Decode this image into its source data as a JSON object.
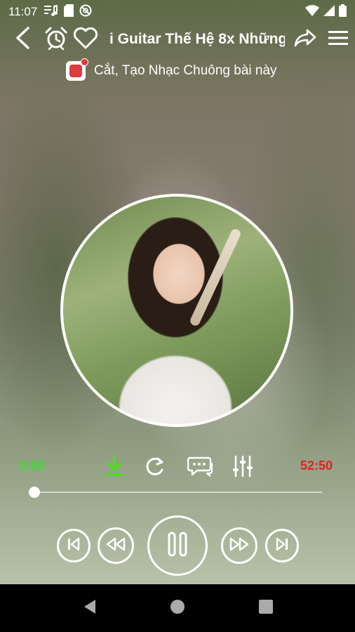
{
  "status_bar": {
    "time": "11:07",
    "icons": [
      "music-notification-icon",
      "sd-card-icon",
      "no-disturb-icon",
      "wifi-icon",
      "signal-icon",
      "battery-icon"
    ]
  },
  "header": {
    "title": "i Guitar Thế Hệ 8x Những",
    "icons": [
      "back-icon",
      "alarm-icon",
      "heart-icon",
      "share-icon",
      "menu-icon"
    ]
  },
  "ringtone": {
    "label": "Cắt, Tạo Nhạc Chuông bài này"
  },
  "player": {
    "current_time": "0:03",
    "total_time": "52:50",
    "progress": 0.001,
    "tools": [
      "download-icon",
      "repeat-icon",
      "lyrics-icon",
      "equalizer-icon"
    ],
    "controls": [
      "skip-previous-icon",
      "rewind-icon",
      "pause-icon",
      "fast-forward-icon",
      "skip-next-icon"
    ]
  },
  "colors": {
    "current_time": "#3ae02a",
    "total_time": "#e22121",
    "download": "#49e019"
  },
  "nav_bar": {
    "icons": [
      "nav-back-icon",
      "nav-home-icon",
      "nav-recents-icon"
    ]
  }
}
